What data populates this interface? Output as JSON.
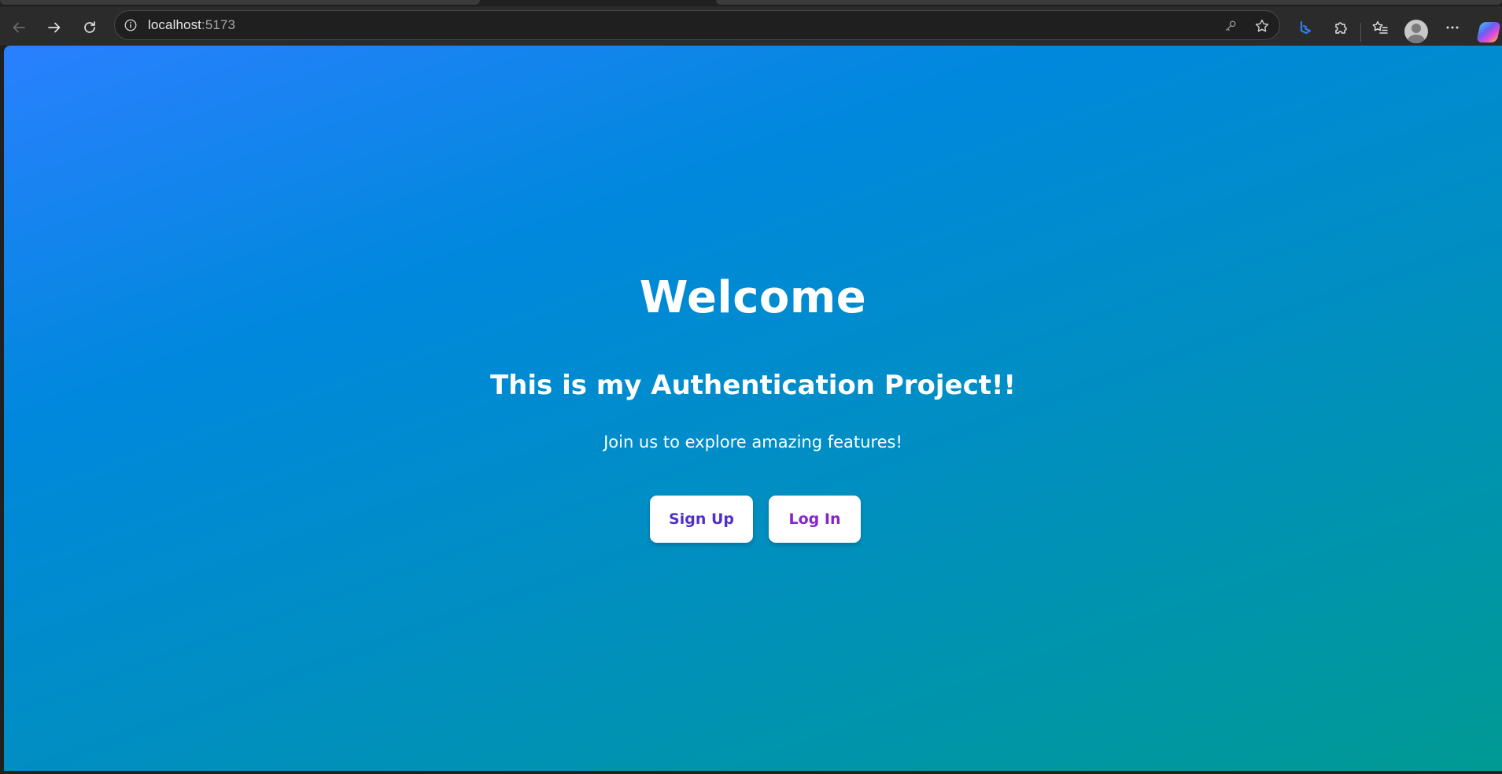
{
  "browser": {
    "url_host": "localhost",
    "url_port": ":5173",
    "icons": {
      "back": "back-arrow-icon",
      "forward": "forward-arrow-icon",
      "refresh": "refresh-icon",
      "site_info": "info-icon",
      "password": "key-icon",
      "favorite": "star-icon",
      "bing": "bing-icon",
      "extensions": "puzzle-icon",
      "favorites": "favorites-icon",
      "profile": "profile-avatar",
      "more": "more-icon",
      "copilot": "copilot-icon"
    }
  },
  "page": {
    "title": "Welcome",
    "subtitle": "This is my Authentication Project!!",
    "tagline": "Join us to explore amazing features!",
    "buttons": {
      "signup": "Sign Up",
      "login": "Log In"
    },
    "colors": {
      "gradient_start": "#2a80ff",
      "gradient_end": "#009a94",
      "signup_text": "#5130c9",
      "login_text": "#8a22c9"
    }
  }
}
